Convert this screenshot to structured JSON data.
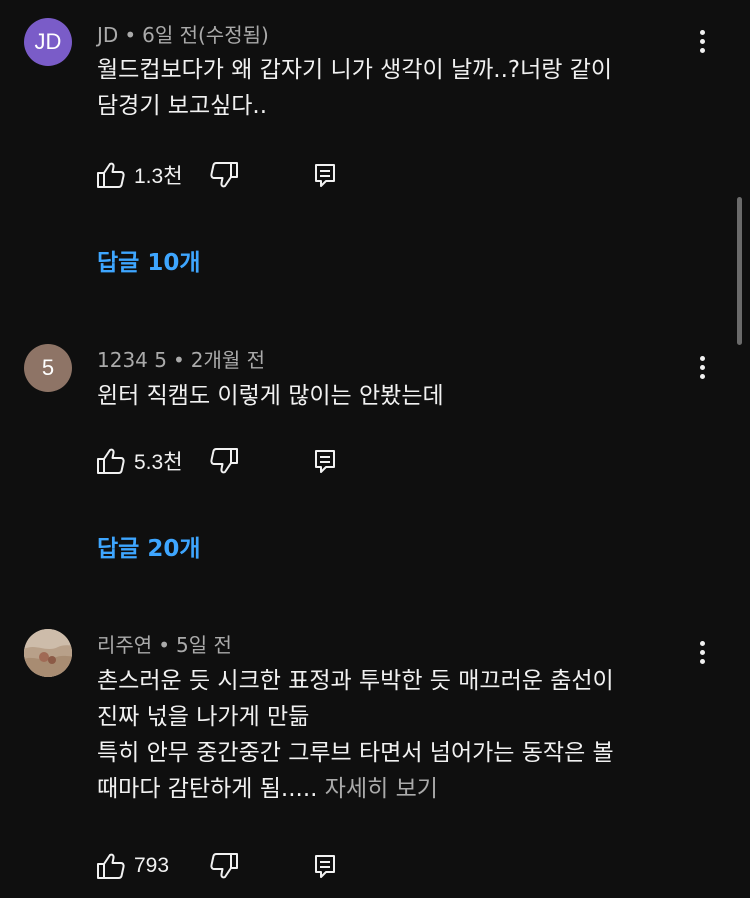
{
  "comments": [
    {
      "author": "JD",
      "time": "6일 전(수정됨)",
      "avatar_letter": "JD",
      "avatar_color": "#7a5cc8",
      "lines": [
        "월드컵보다가 왜 갑자기 니가 생각이 날까..?너랑 같이",
        "담경기 보고싶다.."
      ],
      "likes": "1.3천",
      "replies": "답글 10개"
    },
    {
      "author": "1234 5",
      "time": "2개월 전",
      "avatar_letter": "5",
      "avatar_color": "#8e7466",
      "lines": [
        "윈터 직캠도 이렇게 많이는 안봤는데"
      ],
      "likes": "5.3천",
      "replies": "답글 20개"
    },
    {
      "author": "리주연",
      "time": "5일 전",
      "avatar_color": "#c9b8a6",
      "lines": [
        "촌스러운 듯 시크한 표정과 투박한 듯 매끄러운 춤선이",
        "진짜 넋을 나가게 만듦",
        "특히 안무 중간중간 그루브 타면서 넘어가는 동작은 볼"
      ],
      "last_line": "때마다 감탄하게 됨.....",
      "more": "자세히 보기",
      "likes": "793"
    }
  ],
  "separator": "•"
}
